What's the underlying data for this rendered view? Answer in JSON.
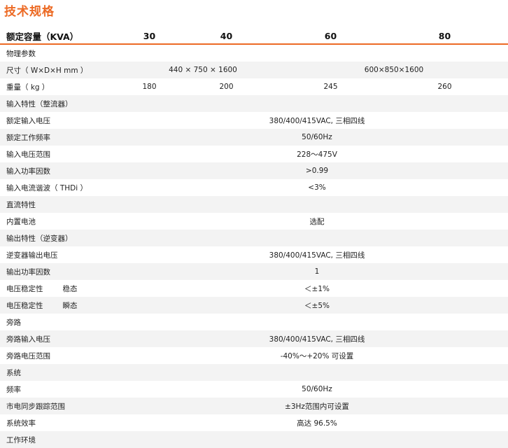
{
  "title": "技术规格",
  "header": {
    "label": "额定容量（KVA）",
    "cols": [
      "30",
      "40",
      "60",
      "80"
    ]
  },
  "rows": {
    "physical": "物理参数",
    "size_label": "尺寸（ W×D×H mm ）",
    "size_small": "440 × 750 × 1600",
    "size_large": "600×850×1600",
    "weight_label": "重量（ kg ）",
    "weights": [
      "180",
      "200",
      "245",
      "260"
    ],
    "input_section": "输入特性（整流器）",
    "input_voltage_label": "额定输入电压",
    "input_voltage": "380/400/415VAC, 三相四线",
    "freq_label": "额定工作频率",
    "freq": "50/60Hz",
    "voltage_range_label": "输入电压范围",
    "voltage_range": "228～475V",
    "pf_label": "输入功率因数",
    "pf": ">0.99",
    "thdi_label": "输入电流谐波（ THDi ）",
    "thdi": "<3%",
    "dc_section": "直流特性",
    "battery_label": "内置电池",
    "battery": "选配",
    "output_section": "输出特性（逆变器）",
    "inv_voltage_label": "逆变器输出电压",
    "inv_voltage": "380/400/415VAC, 三相四线",
    "out_pf_label": "输出功率因数",
    "out_pf": "1",
    "stab_label": "电压稳定性",
    "stab_steady_sub": "稳态",
    "stab_steady": "＜±1%",
    "stab_trans_sub": "瞬态",
    "stab_trans": "＜±5%",
    "bypass_section": "旁路",
    "bypass_voltage_label": "旁路输入电压",
    "bypass_voltage": "380/400/415VAC, 三相四线",
    "bypass_range_label": "旁路电压范围",
    "bypass_range": "-40%～+20% 可设置",
    "system_section": "系统",
    "sys_freq_label": "频率",
    "sys_freq": "50/60Hz",
    "sync_label": "市电同步跟踪范围",
    "sync": "±3Hz范围内可设置",
    "eff_label": "系统效率",
    "eff": "高达 96.5%",
    "env_section": "工作环境"
  }
}
